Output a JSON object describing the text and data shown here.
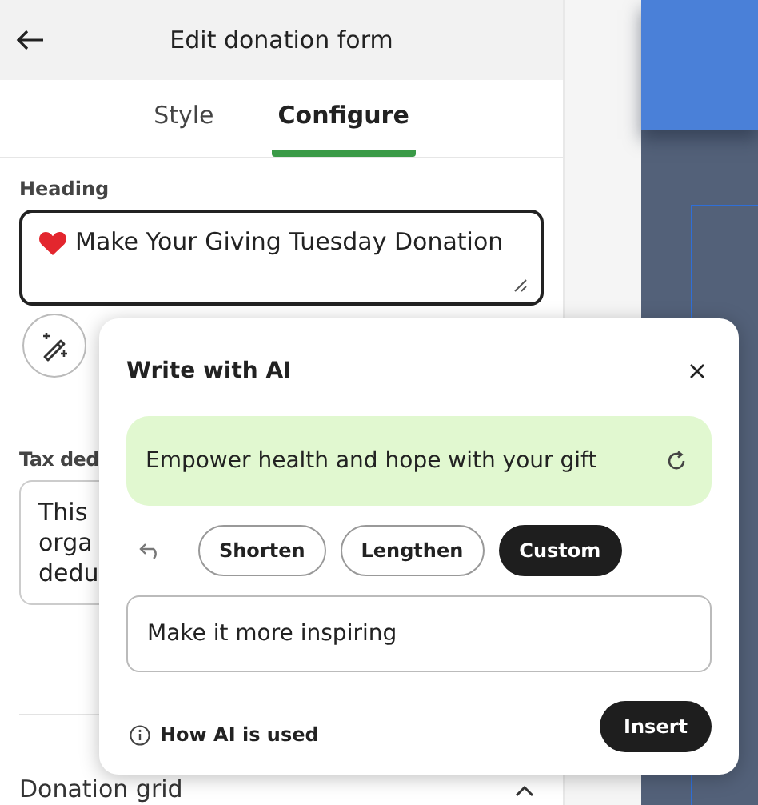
{
  "header": {
    "title": "Edit donation form"
  },
  "tabs": [
    {
      "label": "Style",
      "selected": false
    },
    {
      "label": "Configure",
      "selected": true
    }
  ],
  "heading_field": {
    "label": "Heading",
    "value": "Make Your Giving Tuesday Donation"
  },
  "tax_field": {
    "label": "Tax ded",
    "lines": [
      "This",
      "orga",
      "dedu"
    ]
  },
  "section": {
    "title": "Donation grid",
    "expanded": true
  },
  "ai_popup": {
    "title": "Write with AI",
    "suggestion": "Empower health and hope with your gift",
    "options": [
      {
        "label": "Shorten",
        "selected": false
      },
      {
        "label": "Lengthen",
        "selected": false
      },
      {
        "label": "Custom",
        "selected": true
      }
    ],
    "prompt": {
      "value": "Make it more inspiring"
    },
    "help_link": "How AI is used",
    "insert_button": "Insert"
  }
}
